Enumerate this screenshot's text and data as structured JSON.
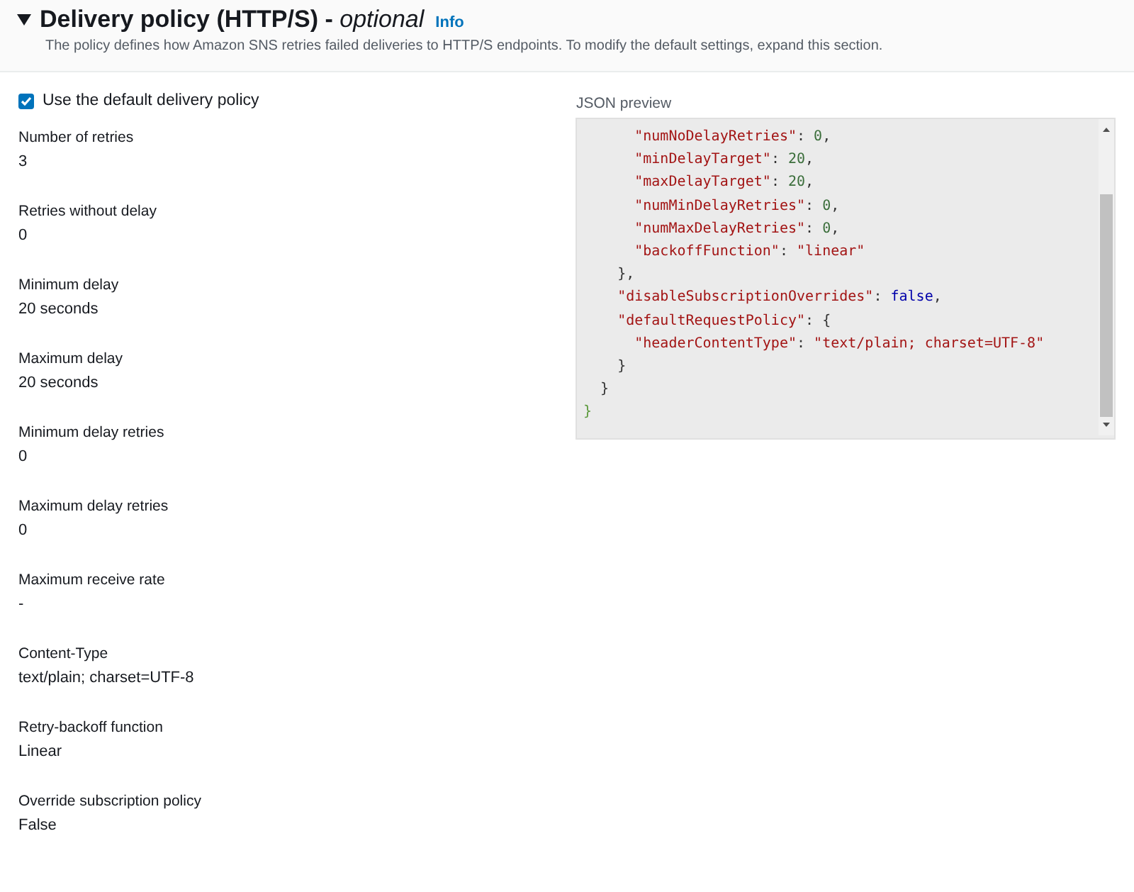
{
  "section": {
    "expanded": true,
    "title": "Delivery policy (HTTP/S) -",
    "title_suffix": "optional",
    "info_link": "Info",
    "description": "The policy defines how Amazon SNS retries failed deliveries to HTTP/S endpoints. To modify the default settings, expand this section."
  },
  "default_policy_checkbox": {
    "label": "Use the default delivery policy",
    "checked": true
  },
  "fields": [
    {
      "label": "Number of retries",
      "value": "3"
    },
    {
      "label": "Retries without delay",
      "value": "0"
    },
    {
      "label": "Minimum delay",
      "value": "20 seconds"
    },
    {
      "label": "Maximum delay",
      "value": "20 seconds"
    },
    {
      "label": "Minimum delay retries",
      "value": "0"
    },
    {
      "label": "Maximum delay retries",
      "value": "0"
    },
    {
      "label": "Maximum receive rate",
      "value": "-"
    },
    {
      "label": "Content-Type",
      "value": "text/plain; charset=UTF-8"
    },
    {
      "label": "Retry-backoff function",
      "value": "Linear"
    },
    {
      "label": "Override subscription policy",
      "value": "False"
    }
  ],
  "json_preview": {
    "label": "JSON preview",
    "lines": [
      [
        {
          "kind": "key",
          "text": "      \"numNoDelayRetries\""
        },
        {
          "kind": "punct",
          "text": ": "
        },
        {
          "kind": "number",
          "text": "0"
        },
        {
          "kind": "punct",
          "text": ","
        }
      ],
      [
        {
          "kind": "key",
          "text": "      \"minDelayTarget\""
        },
        {
          "kind": "punct",
          "text": ": "
        },
        {
          "kind": "number",
          "text": "20"
        },
        {
          "kind": "punct",
          "text": ","
        }
      ],
      [
        {
          "kind": "key",
          "text": "      \"maxDelayTarget\""
        },
        {
          "kind": "punct",
          "text": ": "
        },
        {
          "kind": "number",
          "text": "20"
        },
        {
          "kind": "punct",
          "text": ","
        }
      ],
      [
        {
          "kind": "key",
          "text": "      \"numMinDelayRetries\""
        },
        {
          "kind": "punct",
          "text": ": "
        },
        {
          "kind": "number",
          "text": "0"
        },
        {
          "kind": "punct",
          "text": ","
        }
      ],
      [
        {
          "kind": "key",
          "text": "      \"numMaxDelayRetries\""
        },
        {
          "kind": "punct",
          "text": ": "
        },
        {
          "kind": "number",
          "text": "0"
        },
        {
          "kind": "punct",
          "text": ","
        }
      ],
      [
        {
          "kind": "key",
          "text": "      \"backoffFunction\""
        },
        {
          "kind": "punct",
          "text": ": "
        },
        {
          "kind": "string",
          "text": "\"linear\""
        }
      ],
      [
        {
          "kind": "punct",
          "text": "    },"
        }
      ],
      [
        {
          "kind": "key",
          "text": "    \"disableSubscriptionOverrides\""
        },
        {
          "kind": "punct",
          "text": ": "
        },
        {
          "kind": "boolean",
          "text": "false"
        },
        {
          "kind": "punct",
          "text": ","
        }
      ],
      [
        {
          "kind": "key",
          "text": "    \"defaultRequestPolicy\""
        },
        {
          "kind": "punct",
          "text": ": {"
        }
      ],
      [
        {
          "kind": "key",
          "text": "      \"headerContentType\""
        },
        {
          "kind": "punct",
          "text": ": "
        },
        {
          "kind": "string",
          "text": "\"text/plain; charset=UTF-8\""
        }
      ],
      [
        {
          "kind": "punct",
          "text": "    }"
        }
      ],
      [
        {
          "kind": "punct",
          "text": "  }"
        }
      ],
      [
        {
          "kind": "root",
          "text": "}"
        }
      ]
    ]
  }
}
